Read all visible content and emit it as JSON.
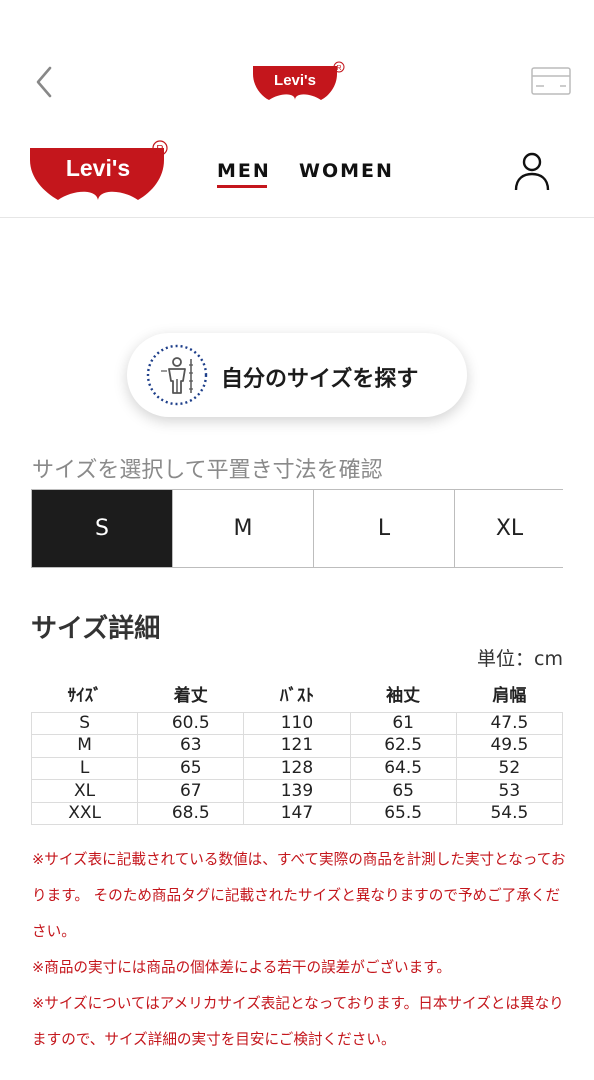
{
  "header": {
    "brand": "Levi's",
    "back_icon": "chevron-left-icon",
    "card_icon": "credit-card-icon"
  },
  "nav": {
    "brand": "Levi's",
    "items": [
      {
        "label": "MEN",
        "active": true
      },
      {
        "label": "WOMEN",
        "active": false
      }
    ],
    "account_icon": "user-icon"
  },
  "find_size": {
    "label": "自分のサイズを探す",
    "icon": "body-measure-icon"
  },
  "size_select": {
    "prompt": "サイズを選択して平置き寸法を確認",
    "sizes": [
      {
        "label": "S",
        "active": true
      },
      {
        "label": "M",
        "active": false
      },
      {
        "label": "L",
        "active": false
      },
      {
        "label": "XL",
        "active": false
      }
    ]
  },
  "size_detail": {
    "title": "サイズ詳細",
    "unit": "単位：cm",
    "headers": [
      "ｻｲｽﾞ",
      "着丈",
      "ﾊﾞｽﾄ",
      "袖丈",
      "肩幅"
    ],
    "rows": [
      [
        "S",
        "60.5",
        "110",
        "61",
        "47.5"
      ],
      [
        "M",
        "63",
        "121",
        "62.5",
        "49.5"
      ],
      [
        "L",
        "65",
        "128",
        "64.5",
        "52"
      ],
      [
        "XL",
        "67",
        "139",
        "65",
        "53"
      ],
      [
        "XXL",
        "68.5",
        "147",
        "65.5",
        "54.5"
      ]
    ]
  },
  "notes": [
    "※サイズ表に記載されている数値は、すべて実際の商品を計測した実寸となっております。 そのため商品タグに記載されたサイズと異なりますので予めご了承ください。",
    "※商品の実寸には商品の個体差による若干の誤差がございます。",
    "※サイズについてはアメリカサイズ表記となっております。日本サイズとは異なりますので、サイズ詳細の実寸を目安にご検討ください。"
  ],
  "colors": {
    "brand_red": "#c4161c",
    "active_tab": "#1c1c1c"
  }
}
